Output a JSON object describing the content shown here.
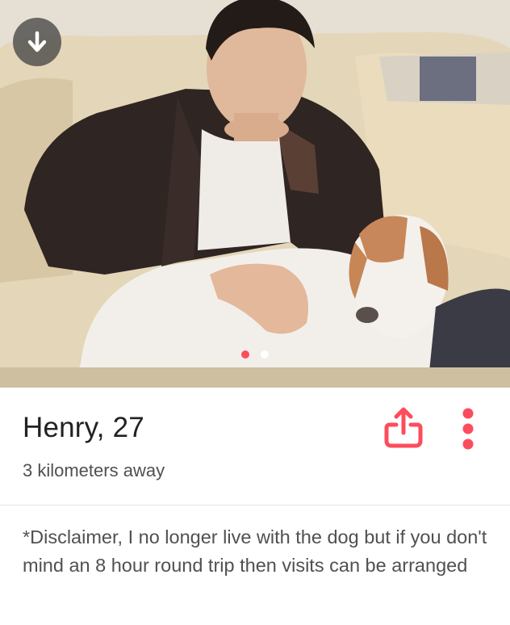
{
  "profile": {
    "name_age": "Henry, 27",
    "distance": "3 kilometers away",
    "bio": "*Disclaimer, I no longer live with the dog but if you don't mind an 8 hour round trip then visits can be arranged"
  },
  "photo": {
    "photo_count": 2,
    "active_index": 0,
    "description_icon": "man-with-dog-photo"
  },
  "icons": {
    "collapse": "down-arrow-icon",
    "share": "share-icon",
    "more": "more-vertical-icon"
  },
  "colors": {
    "accent": "#fd4c5c",
    "text_primary": "#222222",
    "text_secondary": "#505050"
  }
}
